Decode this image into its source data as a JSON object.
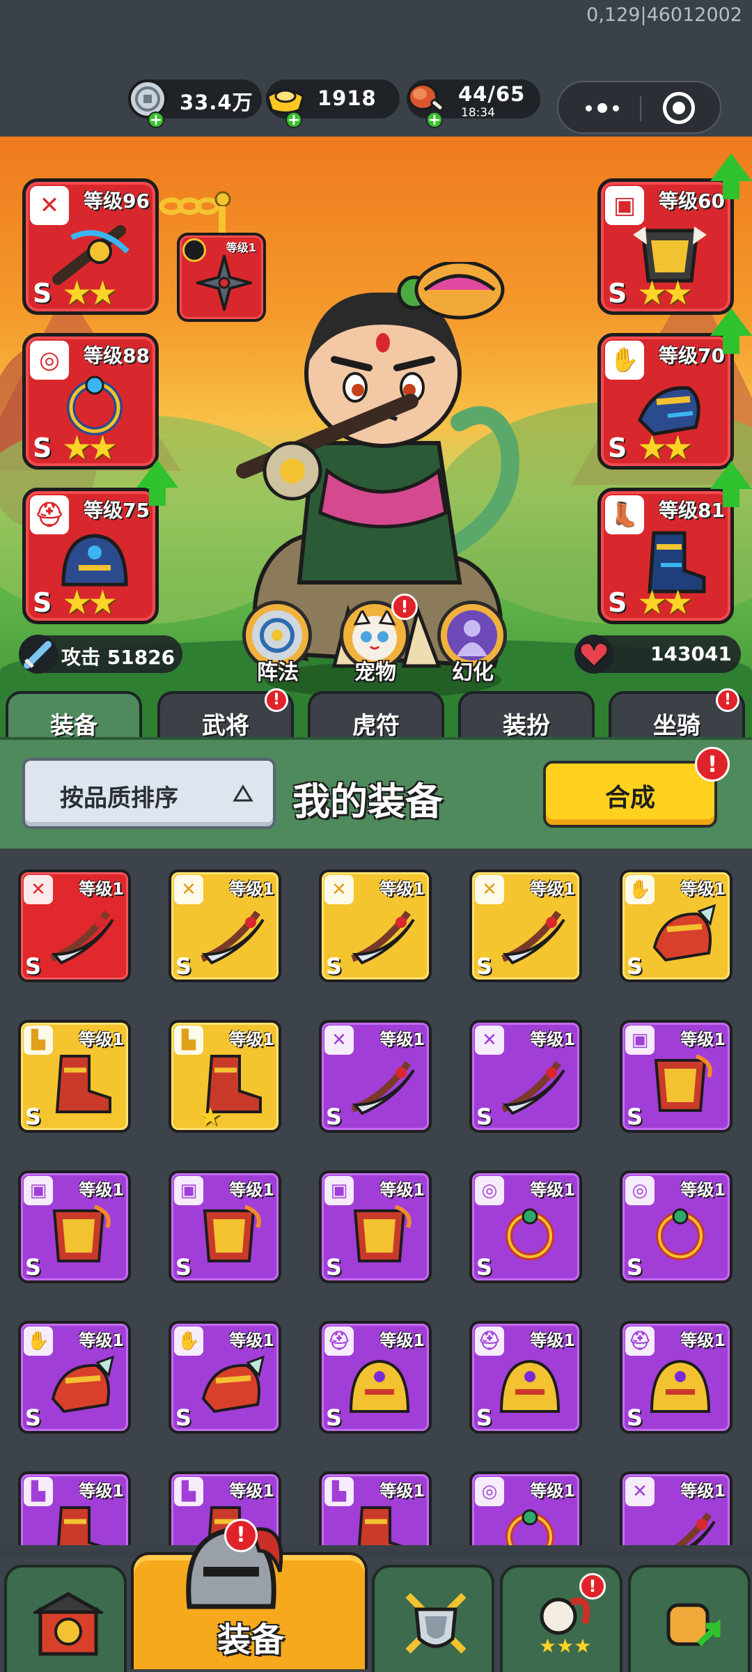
{
  "top": {
    "build_id": "0,129|46012002",
    "resources": {
      "coin": {
        "icon": "coin-icon",
        "value": "33.4万"
      },
      "gold": {
        "icon": "gold-ingot-icon",
        "value": "1918"
      },
      "stamina": {
        "icon": "meat-icon",
        "value": "44/65",
        "timer": "18:34"
      }
    },
    "capsule": {
      "menu_icon": "more-dots-icon",
      "close_icon": "target-close-icon"
    }
  },
  "hero": {
    "equipped": {
      "weapon": {
        "level": "等级96",
        "grade": "S",
        "stars": 2,
        "type_icon": "sword-icon"
      },
      "ring": {
        "level": "等级88",
        "grade": "S",
        "stars": 2,
        "type_icon": "medal-icon"
      },
      "helmet": {
        "level": "等级75",
        "grade": "S",
        "stars": 2,
        "type_icon": "helmet-icon"
      },
      "armor": {
        "level": "等级60",
        "grade": "S",
        "stars": 2,
        "type_icon": "armor-icon"
      },
      "glove": {
        "level": "等级70",
        "grade": "S",
        "stars": 2,
        "type_icon": "glove-icon"
      },
      "boots": {
        "level": "等级81",
        "grade": "S",
        "stars": 2,
        "type_icon": "boot-icon"
      }
    },
    "secondary_weapon": {
      "level": "等级1",
      "icon": "shuriken-icon"
    },
    "skills": [
      {
        "label": "阵法",
        "icon": "formation-icon",
        "badge": false
      },
      {
        "label": "宠物",
        "icon": "cat-pet-icon",
        "badge": true
      },
      {
        "label": "幻化",
        "icon": "transform-icon",
        "badge": false
      }
    ],
    "attack": "攻击 51826",
    "hp": "143041"
  },
  "tabs": [
    {
      "label": "装备",
      "active": true,
      "badge": false
    },
    {
      "label": "武将",
      "active": false,
      "badge": true
    },
    {
      "label": "虎符",
      "active": false,
      "badge": false
    },
    {
      "label": "装扮",
      "active": false,
      "badge": false
    },
    {
      "label": "坐骑",
      "active": false,
      "badge": true
    }
  ],
  "panel": {
    "sort_label": "按品质排序",
    "title": "我的装备",
    "merge_label": "合成",
    "badge": "!"
  },
  "inventory": [
    {
      "rarity": "red",
      "type": "sword",
      "level": "等级1",
      "grade": "S",
      "stars": 0
    },
    {
      "rarity": "gold",
      "type": "sword",
      "level": "等级1",
      "grade": "S",
      "stars": 0
    },
    {
      "rarity": "gold",
      "type": "sword",
      "level": "等级1",
      "grade": "S",
      "stars": 0
    },
    {
      "rarity": "gold",
      "type": "sword",
      "level": "等级1",
      "grade": "S",
      "stars": 0
    },
    {
      "rarity": "gold",
      "type": "glove",
      "level": "等级1",
      "grade": "S",
      "stars": 0
    },
    {
      "rarity": "gold",
      "type": "boot",
      "level": "等级1",
      "grade": "S",
      "stars": 0
    },
    {
      "rarity": "gold",
      "type": "boot",
      "level": "等级1",
      "grade": "",
      "stars": 1
    },
    {
      "rarity": "purple",
      "type": "sword",
      "level": "等级1",
      "grade": "S",
      "stars": 0
    },
    {
      "rarity": "purple",
      "type": "sword",
      "level": "等级1",
      "grade": "S",
      "stars": 0
    },
    {
      "rarity": "purple",
      "type": "armor",
      "level": "等级1",
      "grade": "S",
      "stars": 0
    },
    {
      "rarity": "purple",
      "type": "armor",
      "level": "等级1",
      "grade": "S",
      "stars": 0
    },
    {
      "rarity": "purple",
      "type": "armor",
      "level": "等级1",
      "grade": "S",
      "stars": 0
    },
    {
      "rarity": "purple",
      "type": "armor",
      "level": "等级1",
      "grade": "S",
      "stars": 0
    },
    {
      "rarity": "purple",
      "type": "ring",
      "level": "等级1",
      "grade": "S",
      "stars": 0
    },
    {
      "rarity": "purple",
      "type": "ring",
      "level": "等级1",
      "grade": "S",
      "stars": 0
    },
    {
      "rarity": "purple",
      "type": "glove",
      "level": "等级1",
      "grade": "S",
      "stars": 0
    },
    {
      "rarity": "purple",
      "type": "glove",
      "level": "等级1",
      "grade": "S",
      "stars": 0
    },
    {
      "rarity": "purple",
      "type": "helmet",
      "level": "等级1",
      "grade": "S",
      "stars": 0
    },
    {
      "rarity": "purple",
      "type": "helmet",
      "level": "等级1",
      "grade": "S",
      "stars": 0
    },
    {
      "rarity": "purple",
      "type": "helmet",
      "level": "等级1",
      "grade": "S",
      "stars": 0
    },
    {
      "rarity": "purple",
      "type": "boot",
      "level": "等级1",
      "grade": "",
      "stars": 0
    },
    {
      "rarity": "purple",
      "type": "boot",
      "level": "等级1",
      "grade": "",
      "stars": 0
    },
    {
      "rarity": "purple",
      "type": "boot",
      "level": "等级1",
      "grade": "",
      "stars": 0
    },
    {
      "rarity": "purple",
      "type": "ring",
      "level": "等级1",
      "grade": "",
      "stars": 0
    },
    {
      "rarity": "purple",
      "type": "sword",
      "level": "等级1",
      "grade": "",
      "stars": 0
    }
  ],
  "bottom_nav": [
    {
      "id": "home",
      "icon": "castle-gate-icon",
      "label": "",
      "badge": false
    },
    {
      "id": "equip",
      "icon": "knight-helmet-icon",
      "label": "装备",
      "badge": true
    },
    {
      "id": "battle",
      "icon": "crossed-swords-shield-icon",
      "label": "",
      "badge": false
    },
    {
      "id": "heroes",
      "icon": "hero-stars-icon",
      "label": "",
      "badge": true
    },
    {
      "id": "upgrade",
      "icon": "fist-upgrade-icon",
      "label": "",
      "badge": false
    }
  ],
  "colors": {
    "rarity_red": "#e0282d",
    "rarity_gold": "#f5c530",
    "rarity_purple": "#a13ed8",
    "accent_green": "#4e8a5c",
    "badge_red": "#e0232a"
  }
}
